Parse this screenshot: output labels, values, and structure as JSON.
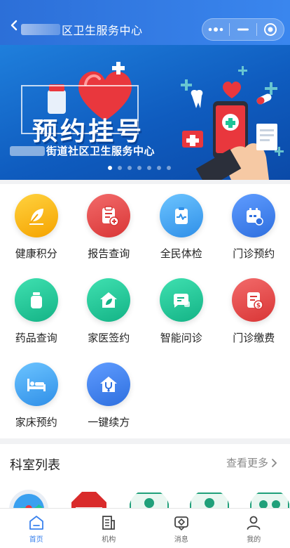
{
  "header": {
    "title": "区卫生服务中心",
    "back_label": "<",
    "menu_icon": "more-dots-icon",
    "minimize_icon": "minimize-icon",
    "close_icon": "target-close-icon"
  },
  "banner": {
    "title": "预约挂号",
    "subtitle": "街道社区卫生服务中心",
    "slide_count": 7,
    "active_slide": 1
  },
  "services": [
    {
      "label": "健康积分",
      "icon": "feather-icon",
      "color": "#f7b500"
    },
    {
      "label": "报告查询",
      "icon": "report-icon",
      "color": "#e64545"
    },
    {
      "label": "全民体检",
      "icon": "clipboard-pulse-icon",
      "color": "#3aa0f0"
    },
    {
      "label": "门诊预约",
      "icon": "calendar-icon",
      "color": "#3f7fe6"
    },
    {
      "label": "药品查询",
      "icon": "medicine-bottle-icon",
      "color": "#20c497"
    },
    {
      "label": "家医签约",
      "icon": "home-leaf-icon",
      "color": "#20c497"
    },
    {
      "label": "智能问诊",
      "icon": "chat-icon",
      "color": "#20c497"
    },
    {
      "label": "门诊缴费",
      "icon": "bill-icon",
      "color": "#e64545"
    },
    {
      "label": "家床预约",
      "icon": "bed-icon",
      "color": "#3aa0f0"
    },
    {
      "label": "一键续方",
      "icon": "stethoscope-home-icon",
      "color": "#3f7fe6"
    }
  ],
  "departments": {
    "title": "科室列表",
    "more_label": "查看更多"
  },
  "tabbar": [
    {
      "label": "首页",
      "icon": "home-icon",
      "active": true
    },
    {
      "label": "机构",
      "icon": "building-icon",
      "active": false
    },
    {
      "label": "消息",
      "icon": "message-icon",
      "active": false
    },
    {
      "label": "我的",
      "icon": "user-icon",
      "active": false
    }
  ]
}
